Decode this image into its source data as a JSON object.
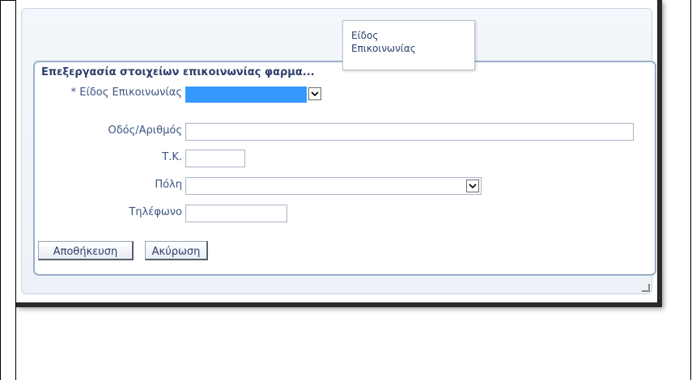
{
  "form": {
    "title": "Επεξεργασία στοιχείων επικοινωνίας φαρμα...",
    "fields": {
      "contact_type_label": "* Είδος Επικοινωνίας",
      "contact_type_value": "",
      "street_label": "Οδός/Αριθμός",
      "street_value": "",
      "postal_label": "Τ.Κ.",
      "postal_value": "",
      "city_label": "Πόλη",
      "city_value": "",
      "phone_label": "Τηλέφωνο",
      "phone_value": ""
    },
    "buttons": {
      "save": "Αποθήκευση",
      "cancel": "Ακύρωση"
    }
  },
  "tooltip": {
    "line1": "Είδος",
    "line2": "Επικοινωνίας"
  },
  "colors": {
    "label": "#3b5680",
    "title": "#2c3e6b",
    "selected_highlight": "#3399ff",
    "panel_border": "#9aaec9"
  },
  "icons": {
    "dropdown": "chevron-down-icon"
  }
}
